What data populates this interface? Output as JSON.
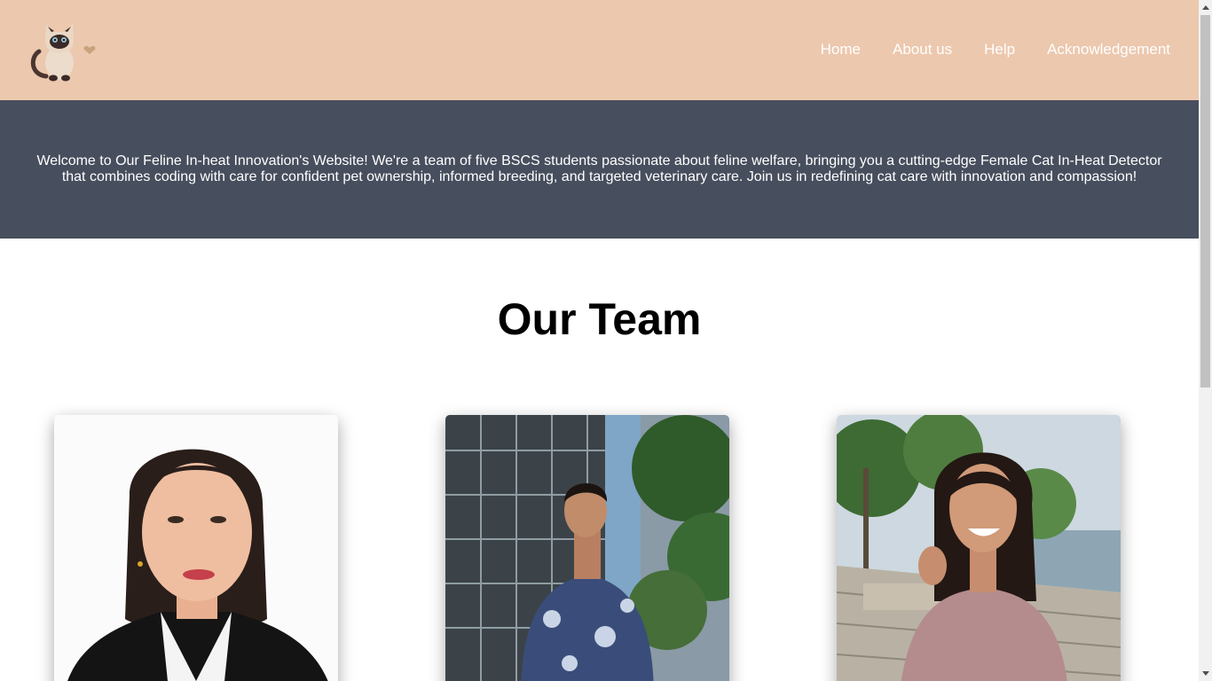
{
  "navbar": {
    "logo_icon": "siamese-cat-logo-icon",
    "links": [
      {
        "label": "Home"
      },
      {
        "label": "About us"
      },
      {
        "label": "Help"
      },
      {
        "label": "Acknowledgement"
      }
    ]
  },
  "banner": {
    "text": "Welcome to Our Feline In-heat Innovation's Website! We're a team of five BSCS students passionate about feline welfare, bringing you a cutting-edge Female Cat In-Heat Detector that combines coding with care for confident pet ownership, informed breeding, and targeted veterinary care. Join us in redefining cat care with innovation and compassion!"
  },
  "team": {
    "title": "Our Team",
    "members": [
      {
        "photo": "woman-formal-portrait-photo"
      },
      {
        "photo": "man-outdoor-building-photo"
      },
      {
        "photo": "woman-seaside-photo"
      }
    ]
  },
  "colors": {
    "navbar_bg": "#ecc8ae",
    "banner_bg": "#474e5d",
    "nav_text": "#ffffff"
  }
}
